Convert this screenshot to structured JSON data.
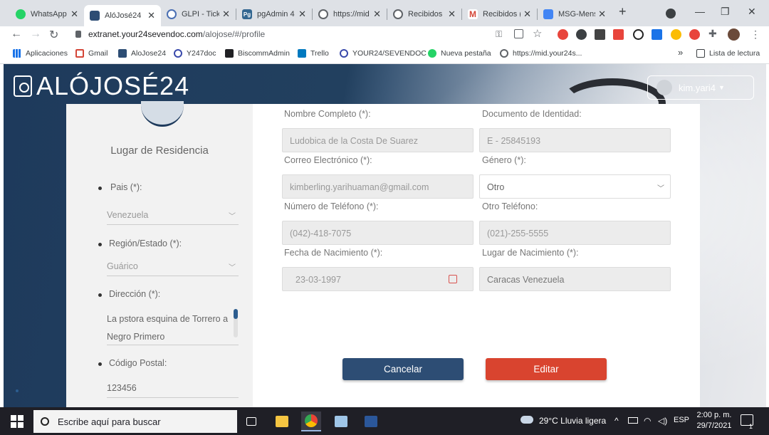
{
  "browser": {
    "tabs": [
      {
        "label": "WhatsApp",
        "icon": "whatsapp-icon",
        "color": "#25d366"
      },
      {
        "label": "AlóJosé24",
        "icon": "alojose-icon",
        "color": "#2d4d74",
        "active": true
      },
      {
        "label": "GLPI - Ticke",
        "icon": "glpi-icon",
        "color": "#4a6fb3"
      },
      {
        "label": "pgAdmin 4",
        "icon": "pgadmin-icon",
        "color": "#336791"
      },
      {
        "label": "https://mid",
        "icon": "globe-icon",
        "color": "#5f6368"
      },
      {
        "label": "Recibidos (",
        "icon": "globe-icon",
        "color": "#5f6368"
      },
      {
        "label": "Recibidos (",
        "icon": "gmail-icon",
        "color": "#d44638"
      },
      {
        "label": "MSG-Mensa",
        "icon": "docs-icon",
        "color": "#4285f4"
      }
    ],
    "new_tab": "+",
    "url": {
      "host": "extranet.your24sevendoc.com",
      "path": "/alojose/#/profile"
    },
    "bookmarks": [
      {
        "label": "Aplicaciones",
        "icon": "apps-icon"
      },
      {
        "label": "Gmail",
        "icon": "gmail-icon"
      },
      {
        "label": "AloJose24",
        "icon": "alojose-icon"
      },
      {
        "label": "Y247doc",
        "icon": "y247-icon"
      },
      {
        "label": "BiscommAdmin",
        "icon": "angular-icon"
      },
      {
        "label": "Trello",
        "icon": "trello-icon"
      },
      {
        "label": "YOUR24/SEVENDOC",
        "icon": "y247-icon"
      },
      {
        "label": "Nueva pestaña",
        "icon": "whatsapp-icon"
      },
      {
        "label": "https://mid.your24s...",
        "icon": "globe-icon"
      }
    ],
    "reading_list": "Lista de lectura",
    "more_bookmarks": "»"
  },
  "app": {
    "brand": "ALÓJOSÉ24",
    "user": "kim.yari4",
    "left": {
      "title": "Lugar de Residencia",
      "country_label": "Pais (*):",
      "country_value": "Venezuela",
      "region_label": "Región/Estado (*):",
      "region_value": "Guárico",
      "address_label": "Dirección (*):",
      "address_value": "La pstora esquina de Torrero a Negro Primero",
      "postal_label": "Código Postal:",
      "postal_value": "123456"
    },
    "form": {
      "fullname_label": "Nombre Completo (*):",
      "fullname_value": "Ludobica de la Costa De Suarez",
      "id_label": "Documento de Identidad:",
      "id_value": "E - 25845193",
      "email_label": "Correo Electrónico (*):",
      "email_value": "kimberling.yarihuaman@gmail.com",
      "gender_label": "Género (*):",
      "gender_value": "Otro",
      "phone_label": "Número de Teléfono (*):",
      "phone_value": "(042)-418-7075",
      "otherphone_label": "Otro Teléfono:",
      "otherphone_value": "(021)-255-5555",
      "birthdate_label": "Fecha de Nacimiento (*):",
      "birthdate_value": "23-03-1997",
      "birthplace_label": "Lugar de Nacimiento (*):",
      "birthplace_value": "Caracas Venezuela"
    },
    "buttons": {
      "cancel": "Cancelar",
      "edit": "Editar"
    }
  },
  "taskbar": {
    "search_placeholder": "Escribe aquí para buscar",
    "weather": "29°C  Lluvia ligera",
    "lang": "ESP",
    "time": "2:00 p. m.",
    "date": "29/7/2021",
    "notifications": "1"
  }
}
